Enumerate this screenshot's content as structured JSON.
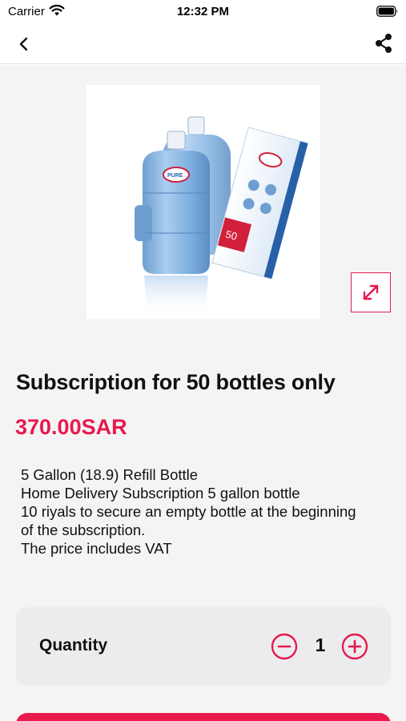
{
  "status_bar": {
    "carrier": "Carrier",
    "time": "12:32 PM"
  },
  "nav": {
    "back_icon": "chevron-left-icon",
    "share_icon": "share-icon"
  },
  "product": {
    "title": "Subscription for 50 bottles only",
    "price": "370.00SAR",
    "description": [
      "5 Gallon (18.9) Refill Bottle",
      "Home Delivery Subscription 5 gallon bottle",
      "10 riyals to secure an empty bottle at the beginning",
      "of the subscription.",
      "The price includes VAT"
    ],
    "image_box_text": {
      "bottle_label": "PURE",
      "box_number": "50"
    }
  },
  "quantity": {
    "label": "Quantity",
    "value": "1"
  },
  "colors": {
    "accent": "#e8194d",
    "background": "#f4f4f5",
    "card": "#ececee"
  }
}
